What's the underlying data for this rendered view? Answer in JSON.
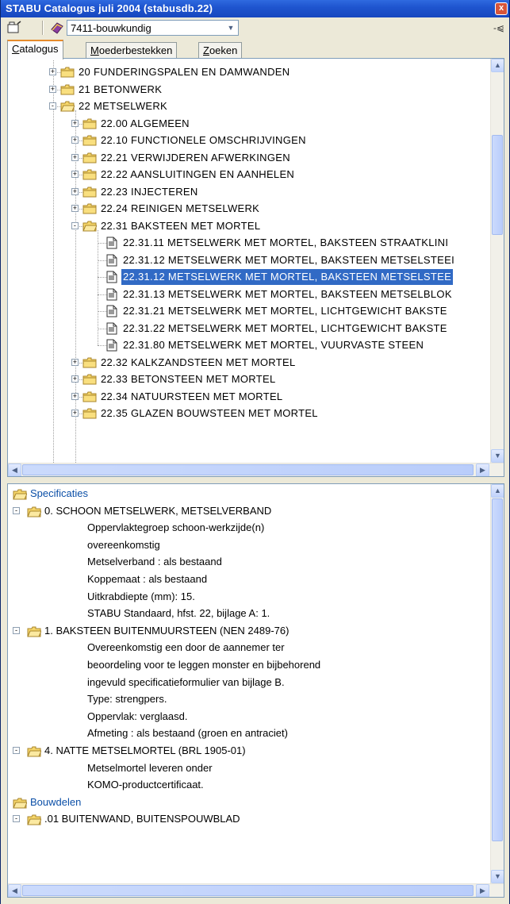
{
  "window": {
    "title": "STABU Catalogus juli 2004 (stabusdb.22)",
    "close_glyph": "x"
  },
  "toolbar": {
    "combo_value": "7411-bouwkundig",
    "pin_glyph": "-⩿"
  },
  "tabs": [
    {
      "pre": "",
      "ul": "C",
      "post": "atalogus"
    },
    {
      "pre": "",
      "ul": "M",
      "post": "oederbestekken"
    },
    {
      "pre": "",
      "ul": "Z",
      "post": "oeken"
    }
  ],
  "tree": [
    {
      "text": "20  FUNDERINGSPALEN EN DAMWANDEN"
    },
    {
      "text": "21  BETONWERK"
    },
    {
      "text": "22  METSELWERK"
    },
    {
      "text": "22.00  ALGEMEEN"
    },
    {
      "text": "22.10  FUNCTIONELE OMSCHRIJVINGEN"
    },
    {
      "text": "22.21  VERWIJDEREN AFWERKINGEN"
    },
    {
      "text": "22.22  AANSLUITINGEN EN AANHELEN"
    },
    {
      "text": "22.23  INJECTEREN"
    },
    {
      "text": "22.24  REINIGEN METSELWERK"
    },
    {
      "text": "22.31  BAKSTEEN MET MORTEL"
    },
    {
      "text": "22.31.11  METSELWERK MET MORTEL, BAKSTEEN STRAATKLINI"
    },
    {
      "text": "22.31.12  METSELWERK MET MORTEL, BAKSTEEN METSELSTEEI"
    },
    {
      "text": "22.31.12  METSELWERK MET MORTEL, BAKSTEEN METSELSTEE"
    },
    {
      "text": "22.31.13  METSELWERK MET MORTEL, BAKSTEEN METSELBLOK"
    },
    {
      "text": "22.31.21  METSELWERK MET MORTEL, LICHTGEWICHT BAKSTE"
    },
    {
      "text": "22.31.22  METSELWERK MET MORTEL, LICHTGEWICHT BAKSTE"
    },
    {
      "text": "22.31.80  METSELWERK MET MORTEL, VUURVASTE STEEN"
    },
    {
      "text": "22.32  KALKZANDSTEEN MET MORTEL"
    },
    {
      "text": "22.33  BETONSTEEN MET MORTEL"
    },
    {
      "text": "22.34  NATUURSTEEN MET MORTEL"
    },
    {
      "text": "22.35  GLAZEN BOUWSTEEN MET MORTEL"
    }
  ],
  "specs": [
    {
      "text": "Specificaties"
    },
    {
      "text": "0.  SCHOON METSELWERK, METSELVERBAND"
    },
    {
      "text": "Oppervlaktegroep schoon-werkzijde(n)"
    },
    {
      "text": "overeenkomstig"
    },
    {
      "text": "Metselverband : als bestaand"
    },
    {
      "text": "Koppemaat : als bestaand"
    },
    {
      "text": "Uitkrabdiepte (mm): 15."
    },
    {
      "text": "STABU Standaard, hfst. 22, bijlage A: 1."
    },
    {
      "text": "1.  BAKSTEEN BUITENMUURSTEEN (NEN 2489-76)"
    },
    {
      "text": "Overeenkomstig een door de aannemer ter"
    },
    {
      "text": "beoordeling voor te leggen monster en bijbehorend"
    },
    {
      "text": "ingevuld specificatieformulier van bijlage B."
    },
    {
      "text": "Type: strengpers."
    },
    {
      "text": "Oppervlak: verglaasd."
    },
    {
      "text": "Afmeting : als bestaand (groen en antraciet)"
    },
    {
      "text": "4.  NATTE METSELMORTEL (BRL 1905-01)"
    },
    {
      "text": "Metselmortel leveren onder"
    },
    {
      "text": "KOMO-productcertificaat."
    },
    {
      "text": "Bouwdelen"
    },
    {
      "text": ".01  BUITENWAND, BUITENSPOUWBLAD"
    }
  ],
  "colors": {
    "title_bar": "#1f55cf",
    "selection": "#316ac5",
    "folder": "#f6d66a",
    "link_blue": "#0b4fa7"
  }
}
